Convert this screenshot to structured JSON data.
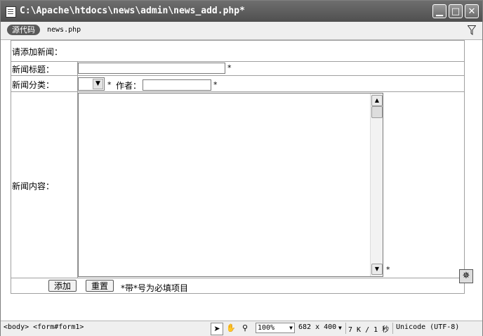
{
  "window": {
    "title": "C:\\Apache\\htdocs\\news\\admin\\news_add.php*",
    "controls": {
      "minimize": "▁",
      "maximize": "□",
      "close": "✕"
    }
  },
  "toolbar": {
    "source_tab": "源代码",
    "file_tab": "news.php",
    "filter_icon": "filter-icon"
  },
  "form": {
    "heading": "请添加新闻：",
    "title_label": "新闻标题：",
    "title_value": "",
    "category_label": "新闻分类：",
    "category_selected": "",
    "author_label": "作者：",
    "author_value": "",
    "content_label": "新闻内容：",
    "content_value": "",
    "required_mark": "*",
    "submit_label": "添加",
    "reset_label": "重置",
    "note": "*带*号为必填项目"
  },
  "statusbar": {
    "tag_path": "<body> <form#form1>",
    "zoom": "100%",
    "dimensions": "682 x 400",
    "size_time": "7 K / 1 秒",
    "encoding": "Unicode (UTF-8)"
  },
  "colors": {
    "titlebar": "#5a5a5a",
    "border": "#a0a0a0",
    "toolbar_bg": "#efefef"
  }
}
